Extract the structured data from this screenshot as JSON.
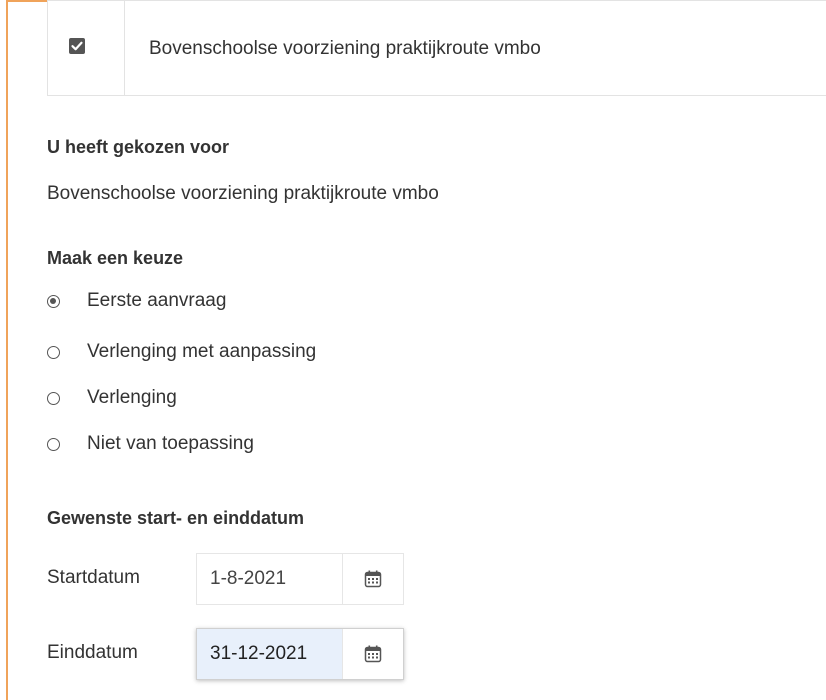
{
  "selected_option": {
    "checked": true,
    "label": "Bovenschoolse voorziening praktijkroute vmbo"
  },
  "chosen": {
    "heading": "U heeft gekozen voor",
    "value": "Bovenschoolse voorziening praktijkroute vmbo"
  },
  "choice": {
    "heading": "Maak een keuze",
    "options": [
      {
        "label": "Eerste aanvraag",
        "selected": true
      },
      {
        "label": "Verlenging met aanpassing",
        "selected": false
      },
      {
        "label": "Verlenging",
        "selected": false
      },
      {
        "label": "Niet van toepassing",
        "selected": false
      }
    ]
  },
  "dates": {
    "heading": "Gewenste start- en einddatum",
    "start_label": "Startdatum",
    "start_value": "1-8-2021",
    "end_label": "Einddatum",
    "end_value": "31-12-2021"
  },
  "colors": {
    "frame_accent": "#f0a35a",
    "focused_input": "#e8f0fb"
  }
}
